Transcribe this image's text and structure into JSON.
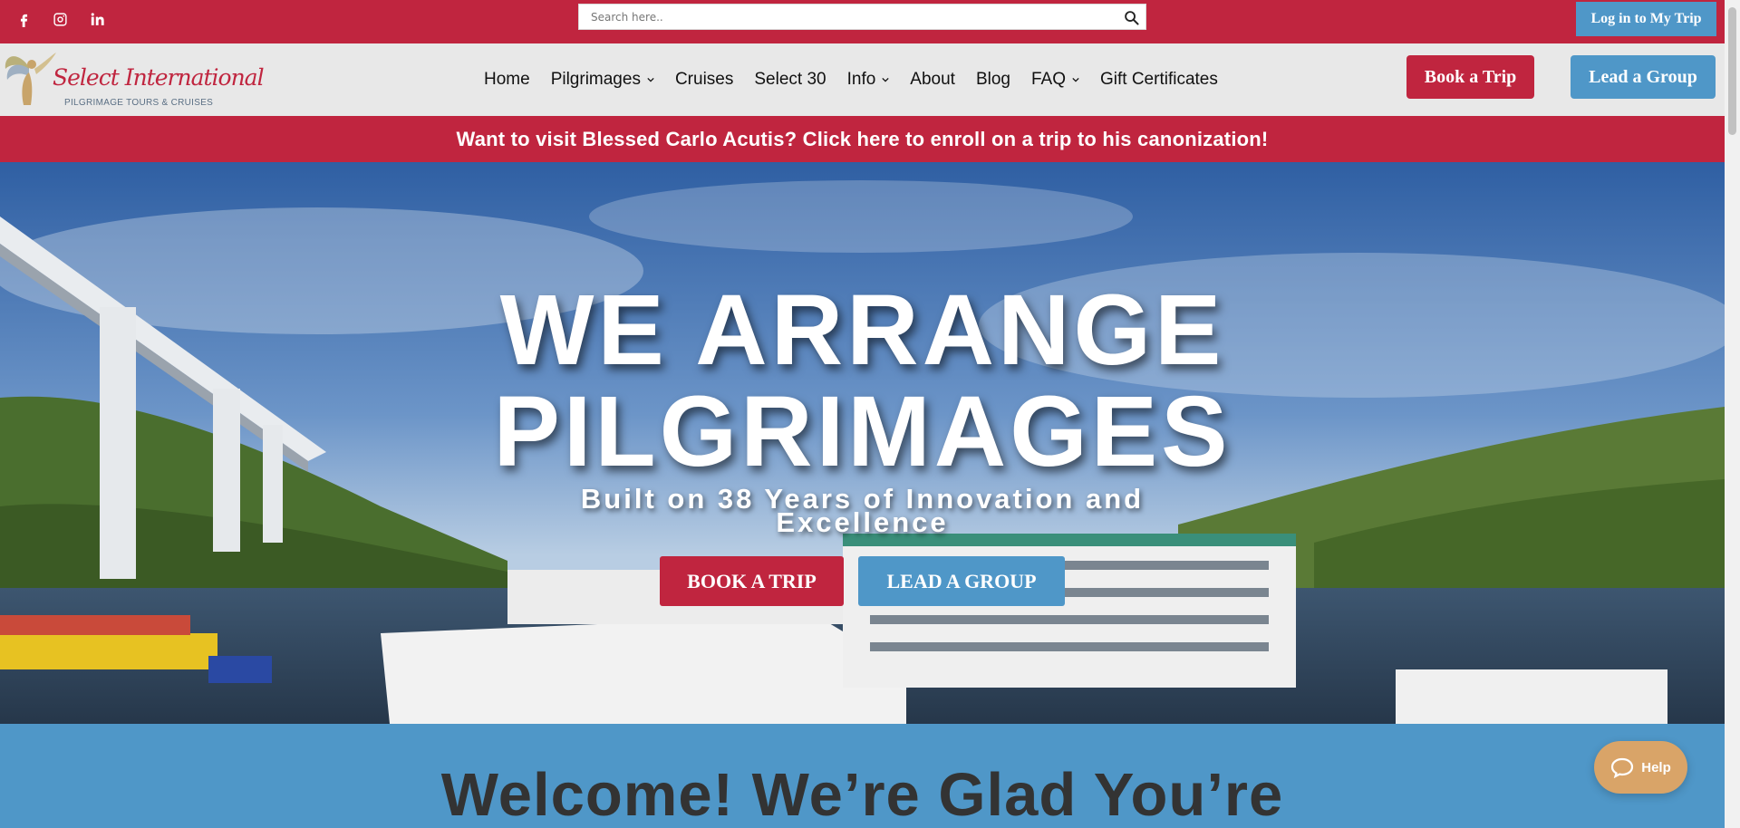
{
  "topbar": {
    "social": [
      {
        "name": "facebook-icon",
        "glyph": "f"
      },
      {
        "name": "instagram-icon",
        "glyph": "ig"
      },
      {
        "name": "linkedin-icon",
        "glyph": "in"
      }
    ],
    "search_placeholder": "Search here..",
    "login_label": "Log in to My Trip"
  },
  "logo": {
    "name": "Select International",
    "tagline": "PILGRIMAGE TOURS & CRUISES"
  },
  "nav": {
    "items": [
      {
        "label": "Home",
        "dropdown": false
      },
      {
        "label": "Pilgrimages",
        "dropdown": true
      },
      {
        "label": "Cruises",
        "dropdown": false
      },
      {
        "label": "Select 30",
        "dropdown": false
      },
      {
        "label": "Info",
        "dropdown": true
      },
      {
        "label": "About",
        "dropdown": false
      },
      {
        "label": "Blog",
        "dropdown": false
      },
      {
        "label": "FAQ",
        "dropdown": true
      },
      {
        "label": "Gift Certificates",
        "dropdown": false
      }
    ],
    "book_label": "Book a Trip",
    "lead_label": "Lead a Group"
  },
  "announcement": "Want to visit Blessed Carlo Acutis? Click here to enroll on a trip to his canonization!",
  "hero": {
    "title_line1": "WE ARRANGE",
    "title_line2": "PILGRIMAGES",
    "subtitle": "Built on 38 Years of Innovation and Excellence",
    "book_label": "BOOK A TRIP",
    "lead_label": "LEAD A GROUP"
  },
  "welcome": {
    "heading": "Welcome! We’re Glad You’re"
  },
  "help": {
    "label": "Help"
  },
  "colors": {
    "brand_red": "#c0253f",
    "brand_blue": "#4f97c8",
    "help_tan": "#d9a468",
    "nav_bg": "#e8e8e8"
  }
}
